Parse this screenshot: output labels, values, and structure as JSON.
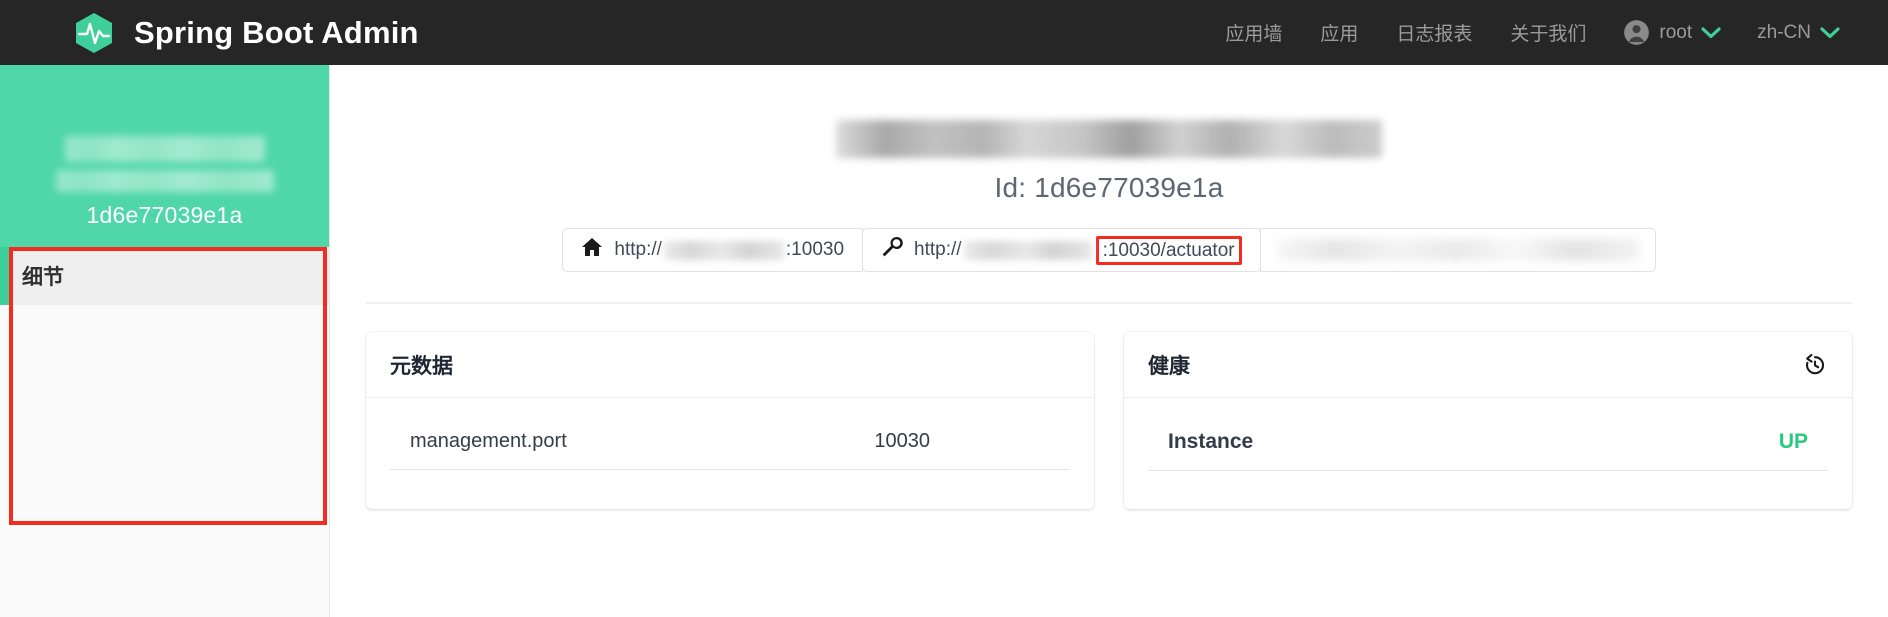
{
  "navbar": {
    "brand": "Spring Boot Admin",
    "logo_icon": "heartbeat-hexagon-icon",
    "links": [
      {
        "label": "应用墙"
      },
      {
        "label": "应用"
      },
      {
        "label": "日志报表"
      },
      {
        "label": "关于我们"
      }
    ],
    "user": {
      "label": "root",
      "icon": "user-avatar-icon",
      "chevron": "chevron-down-icon"
    },
    "language": {
      "label": "zh-CN",
      "chevron": "chevron-down-icon"
    }
  },
  "sidebar": {
    "app_name_blurred": "",
    "instance_id": "1d6e77039e1a",
    "items": [
      {
        "label": "细节",
        "active": true
      }
    ]
  },
  "main": {
    "title_blurred": "",
    "instance_label": "Id: 1d6e77039e1a",
    "tags": [
      {
        "icon": "home-icon",
        "prefix": "http://",
        "suffix": ":10030",
        "blurred": true
      },
      {
        "icon": "wrench-icon",
        "prefix": "http://",
        "suffix": ":10030/actuator",
        "blurred": true,
        "highlighted": true
      },
      {
        "icon": "none",
        "prefix": "",
        "suffix": "",
        "blurred": true
      }
    ],
    "metadata_card": {
      "title": "元数据",
      "rows": [
        {
          "key": "management.port",
          "value": "10030"
        }
      ]
    },
    "health_card": {
      "title": "健康",
      "history_icon": "history-restore-icon",
      "rows": [
        {
          "key": "Instance",
          "value": "UP"
        }
      ]
    }
  },
  "colors": {
    "navbar_bg": "#262626",
    "accent_green": "#3ecf9a",
    "sidebar_header": "#4fd6a9",
    "status_up": "#27c97f",
    "annotation_red": "#f42b21",
    "text_muted": "#9b9b9b"
  }
}
